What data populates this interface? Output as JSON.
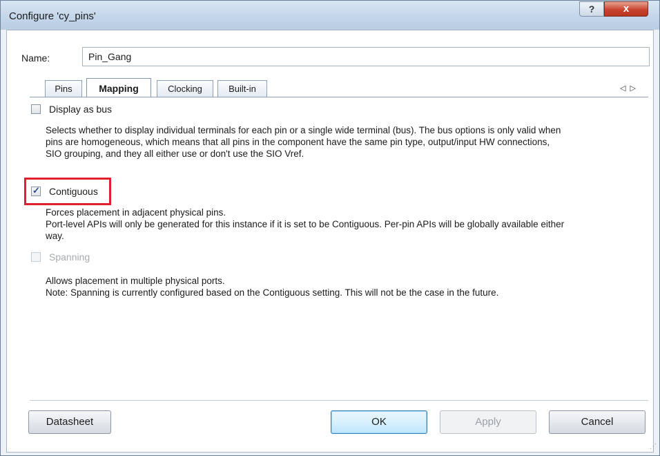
{
  "window": {
    "title": "Configure 'cy_pins'",
    "help_glyph": "?",
    "close_glyph": "x"
  },
  "name_field": {
    "label": "Name:",
    "value": "Pin_Gang"
  },
  "tabs": [
    {
      "label": "Pins",
      "active": false
    },
    {
      "label": "Mapping",
      "active": true
    },
    {
      "label": "Clocking",
      "active": false
    },
    {
      "label": "Built-in",
      "active": false
    }
  ],
  "tab_scroll": {
    "left": "◁",
    "right": "▷"
  },
  "options": [
    {
      "label": "Display as bus",
      "checked": false,
      "enabled": true,
      "description": [
        "Selects whether to display individual terminals for each pin or a single wide terminal (bus). The bus options is only valid when",
        "pins are homogeneous, which means that all pins in the component have the same pin type, output/input HW connections,",
        "SIO grouping, and they all either use or don't use the SIO Vref."
      ]
    },
    {
      "label": "Contiguous",
      "checked": true,
      "enabled": true,
      "description": [
        "Forces placement in adjacent physical pins.",
        "Port-level APIs will only be generated for this instance if it is set to be Contiguous. Per-pin APIs will be globally available either",
        "way."
      ]
    },
    {
      "label": "Spanning",
      "checked": false,
      "enabled": false,
      "description": [
        "Allows placement in multiple physical ports.",
        "Note: Spanning is currently configured based on the Contiguous setting. This will not be the case in the future."
      ]
    }
  ],
  "buttons": {
    "datasheet": "Datasheet",
    "ok": "OK",
    "apply": "Apply",
    "cancel": "Cancel"
  },
  "colors": {
    "highlight": "#e0202a",
    "close": "#c9442f",
    "check": "#2a4a87"
  }
}
